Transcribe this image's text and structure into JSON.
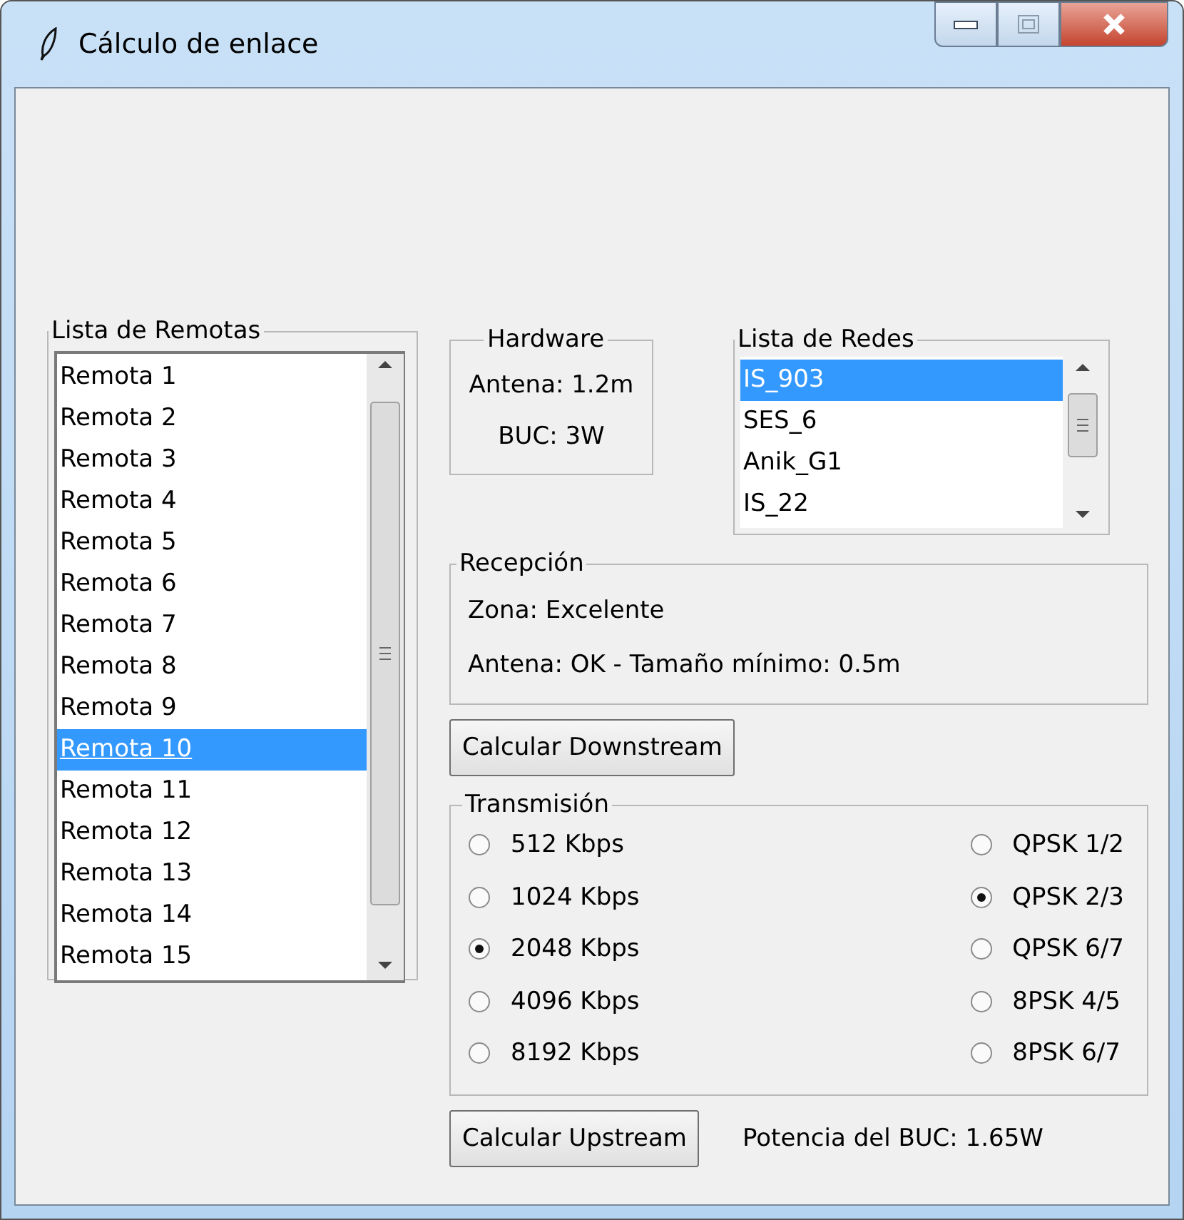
{
  "window": {
    "title": "Cálculo de enlace"
  },
  "remotes": {
    "label": "Lista de Remotas",
    "items": [
      {
        "text": "Remota 1",
        "selected": false
      },
      {
        "text": "Remota 2",
        "selected": false
      },
      {
        "text": "Remota 3",
        "selected": false
      },
      {
        "text": "Remota 4",
        "selected": false
      },
      {
        "text": "Remota 5",
        "selected": false
      },
      {
        "text": "Remota 6",
        "selected": false
      },
      {
        "text": "Remota 7",
        "selected": false
      },
      {
        "text": "Remota 8",
        "selected": false
      },
      {
        "text": "Remota 9",
        "selected": false
      },
      {
        "text": "Remota 10",
        "selected": true
      },
      {
        "text": "Remota 11",
        "selected": false
      },
      {
        "text": "Remota 12",
        "selected": false
      },
      {
        "text": "Remota 13",
        "selected": false
      },
      {
        "text": "Remota 14",
        "selected": false
      },
      {
        "text": "Remota 15",
        "selected": false
      }
    ]
  },
  "hardware": {
    "label": "Hardware",
    "lines": [
      "Antena: 1.2m",
      "BUC: 3W"
    ]
  },
  "networks": {
    "label": "Lista de Redes",
    "items": [
      {
        "text": "IS_903",
        "selected": true
      },
      {
        "text": "SES_6",
        "selected": false
      },
      {
        "text": "Anik_G1",
        "selected": false
      },
      {
        "text": "IS_22",
        "selected": false
      }
    ]
  },
  "reception": {
    "label": "Recepción",
    "lines": [
      "Zona: Excelente",
      "Antena: OK - Tamaño mínimo: 0.5m"
    ]
  },
  "downstream_button": "Calcular Downstream",
  "transmission": {
    "label": "Transmisión",
    "rates": [
      {
        "label": "512 Kbps",
        "selected": false
      },
      {
        "label": "1024 Kbps",
        "selected": false
      },
      {
        "label": "2048 Kbps",
        "selected": true
      },
      {
        "label": "4096 Kbps",
        "selected": false
      },
      {
        "label": "8192 Kbps",
        "selected": false
      }
    ],
    "modulations": [
      {
        "label": "QPSK 1/2",
        "selected": false
      },
      {
        "label": "QPSK 2/3",
        "selected": true
      },
      {
        "label": "QPSK 6/7",
        "selected": false
      },
      {
        "label": "8PSK 4/5",
        "selected": false
      },
      {
        "label": "8PSK 6/7",
        "selected": false
      }
    ]
  },
  "upstream_button": "Calcular Upstream",
  "buc_power": "Potencia del BUC: 1.65W"
}
